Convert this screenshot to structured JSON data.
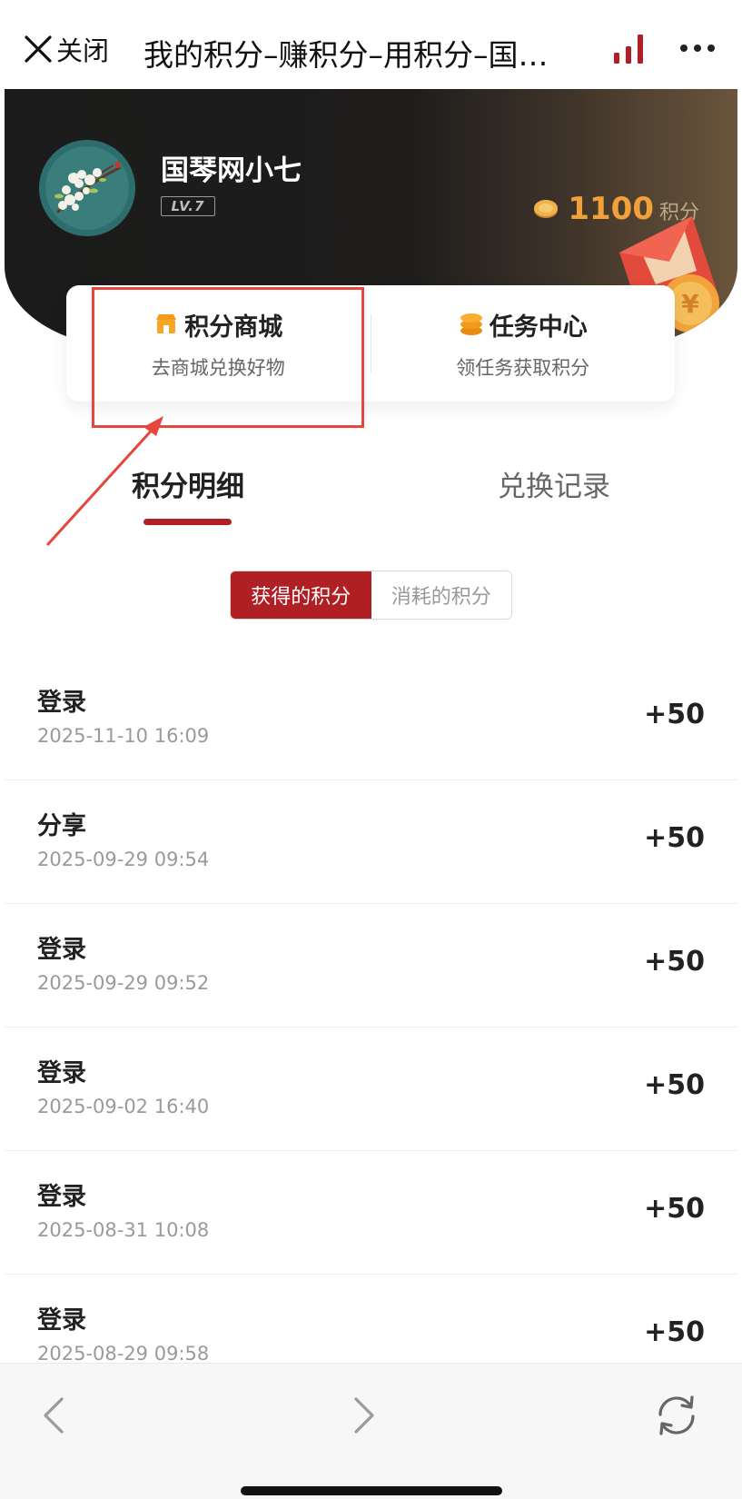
{
  "nav": {
    "close_label": "关闭",
    "title": "我的积分–赚积分–用积分–国…",
    "accent_color": "#b01f24"
  },
  "profile": {
    "username": "国琴网小七",
    "level": "LV.7",
    "points": "1100",
    "points_unit": "积分",
    "points_color": "#f2a13a"
  },
  "entries": [
    {
      "title": "积分商城",
      "subtitle": "去商城兑换好物",
      "icon": "shop-icon"
    },
    {
      "title": "任务中心",
      "subtitle": "领任务获取积分",
      "icon": "coins-stack-icon"
    }
  ],
  "tabs": [
    {
      "label": "积分明细",
      "active": true
    },
    {
      "label": "兑换记录",
      "active": false
    }
  ],
  "segment": {
    "earned_label": "获得的积分",
    "spent_label": "消耗的积分",
    "active": "earned"
  },
  "records": [
    {
      "title": "登录",
      "time": "2025-11-10 16:09",
      "points": "+50"
    },
    {
      "title": "分享",
      "time": "2025-09-29 09:54",
      "points": "+50"
    },
    {
      "title": "登录",
      "time": "2025-09-29 09:52",
      "points": "+50"
    },
    {
      "title": "登录",
      "time": "2025-09-02 16:40",
      "points": "+50"
    },
    {
      "title": "登录",
      "time": "2025-08-31 10:08",
      "points": "+50"
    },
    {
      "title": "登录",
      "time": "2025-08-29 09:58",
      "points": "+50"
    }
  ],
  "annotation_color": "#e5473c"
}
